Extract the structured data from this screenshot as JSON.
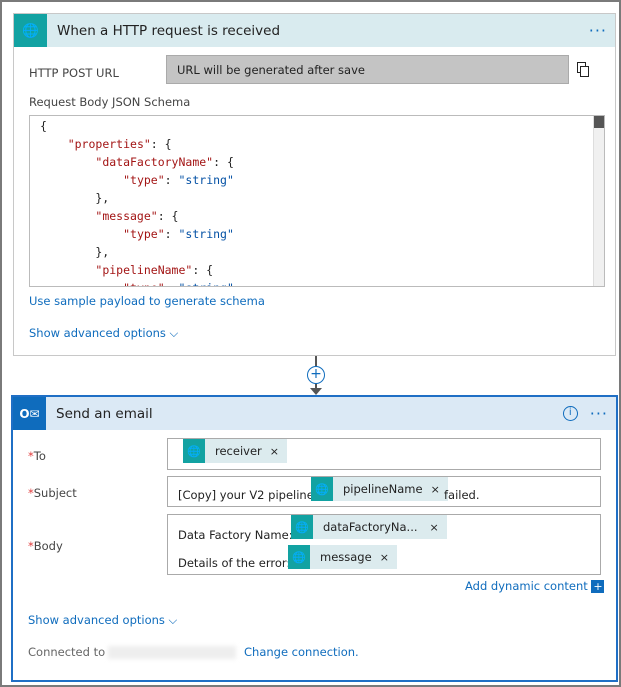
{
  "trigger": {
    "title": "When a HTTP request is received",
    "menu": "···",
    "icon": "globe-icon",
    "url_label": "HTTP POST URL",
    "url_value": "URL will be generated after save",
    "copy_icon": "copy-icon",
    "schema_label": "Request Body JSON Schema",
    "schema_lines": [
      "{",
      "    \"properties\": {",
      "        \"dataFactoryName\": {",
      "            \"type\": \"string\"",
      "        },",
      "        \"message\": {",
      "            \"type\": \"string\"",
      "        },",
      "        \"pipelineName\": {",
      "            \"type\": \"string\""
    ],
    "sample_link": "Use sample payload to generate schema",
    "advanced": "Show advanced options"
  },
  "connector": {
    "add": "+"
  },
  "email": {
    "title": "Send an email",
    "menu": "···",
    "info": "i",
    "icon": "outlook-icon",
    "to_label": "To",
    "subject_label": "Subject",
    "body_label": "Body",
    "required": "*",
    "to_token": "receiver",
    "subject_prefix": "[Copy] your V2 pipeline",
    "subject_token": "pipelineName",
    "subject_suffix": "failed.",
    "body_line1": "Data Factory Name:",
    "body_token1": "dataFactoryNa...",
    "body_line2": "Details of the error:",
    "body_token2": "message",
    "token_remove": "×",
    "add_dynamic": "Add dynamic content",
    "add_dynamic_icon": "+",
    "advanced": "Show advanced options",
    "connected_to": "Connected to",
    "change_connection": "Change connection."
  },
  "colors": {
    "teal": "#12a2a2",
    "blue": "#0f6cbd",
    "border_active": "#1f6fc5"
  }
}
